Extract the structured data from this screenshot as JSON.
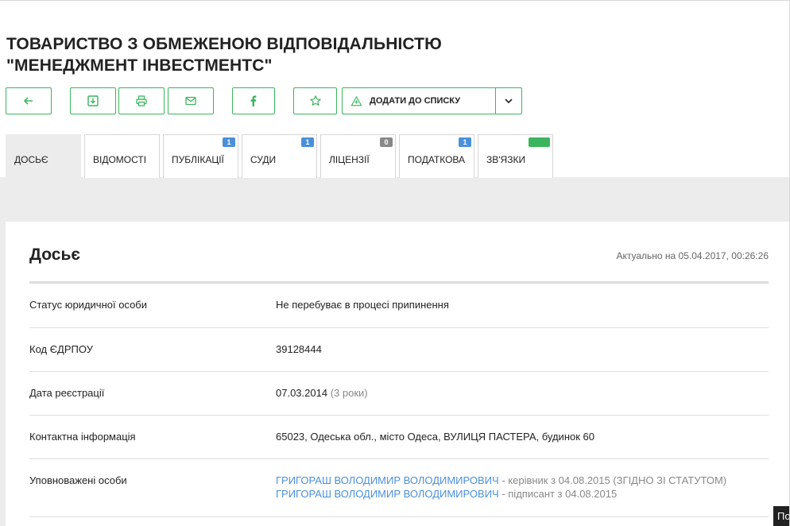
{
  "company": {
    "title_line1": "ТОВАРИСТВО З ОБМЕЖЕНОЮ ВІДПОВІДАЛЬНІСТЮ",
    "title_line2": "\"МЕНЕДЖМЕНТ ІНВЕСТМЕНТС\""
  },
  "toolbar": {
    "icons": [
      "back-arrow-icon",
      "download-icon",
      "print-icon",
      "email-icon",
      "facebook-icon",
      "star-icon",
      "list-add-icon",
      "chevron-down-icon"
    ],
    "add_to_list_label": "ДОДАТИ ДО СПИСКУ"
  },
  "tabs": [
    {
      "label": "ДОСЬЄ",
      "active": true,
      "badge": ""
    },
    {
      "label": "ВІДОМОСТІ",
      "active": false,
      "badge": ""
    },
    {
      "label": "ПУБЛІКАЦІЇ",
      "active": false,
      "badge": "1"
    },
    {
      "label": "СУДИ",
      "active": false,
      "badge": "1"
    },
    {
      "label": "ЛІЦЕНЗІЇ",
      "active": false,
      "badge": "0"
    },
    {
      "label": "ПОДАТКОВА",
      "active": false,
      "badge": "1"
    },
    {
      "label": "ЗВ'ЯЗКИ",
      "active": false,
      "badge": "beta"
    }
  ],
  "dossier": {
    "title": "Досьє",
    "updated": "Актуально на 05.04.2017, 00:26:26",
    "rows": [
      {
        "label": "Статус юридичної особи",
        "value": "Не перебуває в процесі припинення"
      },
      {
        "label": "Код ЄДРПОУ",
        "value": "39128444"
      },
      {
        "label": "Дата реєстрації",
        "value": "07.03.2014",
        "extra": "(3 роки)"
      },
      {
        "label": "Контактна інформація",
        "value": "65023, Одеська обл., місто Одеса, ВУЛИЦЯ ПАСТЕРА, будинок 60"
      },
      {
        "label": "Уповноважені особи",
        "persons": [
          {
            "name": "ГРИГОРАШ ВОЛОДИМИР ВОЛОДИМИРОВИЧ",
            "role": "- керівник з 04.08.2015 (ЗГІДНО ЗІ СТАТУТОМ)"
          },
          {
            "name": "ГРИГОРАШ ВОЛОДИМИР ВОЛОДИМИРОВИЧ",
            "role": "- підписант з 04.08.2015"
          }
        ]
      }
    ]
  },
  "corner_text": "По",
  "colors": {
    "accent": "#3cb55e",
    "link": "#4a90d9",
    "badge_blue": "#4a90d9",
    "badge_gray": "#888888",
    "band": "#ececec"
  }
}
